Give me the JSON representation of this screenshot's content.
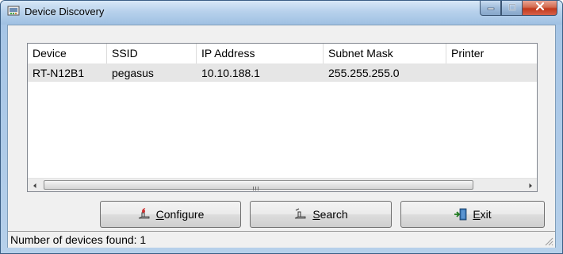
{
  "window": {
    "title": "Device Discovery",
    "icon": "network-device-icon",
    "controls": [
      "minimize-icon",
      "maximize-icon",
      "close-icon"
    ]
  },
  "device_list": {
    "columns": [
      "Device",
      "SSID",
      "IP Address",
      "Subnet Mask",
      "Printer"
    ],
    "rows": [
      [
        "RT-N12B1",
        "pegasus",
        "10.10.188.1",
        "255.255.255.0",
        ""
      ]
    ],
    "selected_row": 0
  },
  "buttons": {
    "configure": {
      "mnemonic": "C",
      "rest": "onfigure",
      "icon": "configure-icon"
    },
    "search": {
      "mnemonic": "S",
      "rest": "earch",
      "icon": "search-device-icon"
    },
    "exit": {
      "mnemonic": "E",
      "rest": "xit",
      "icon": "exit-door-icon"
    }
  },
  "status": {
    "text": "Number of devices found: 1"
  },
  "colors": {
    "title_gradient_top": "#d8e8f7",
    "title_gradient_bottom": "#9fc0e2",
    "close_button": "#c2391c",
    "selected_row": "#e6e6e6",
    "client_background": "#f0f0f0"
  }
}
